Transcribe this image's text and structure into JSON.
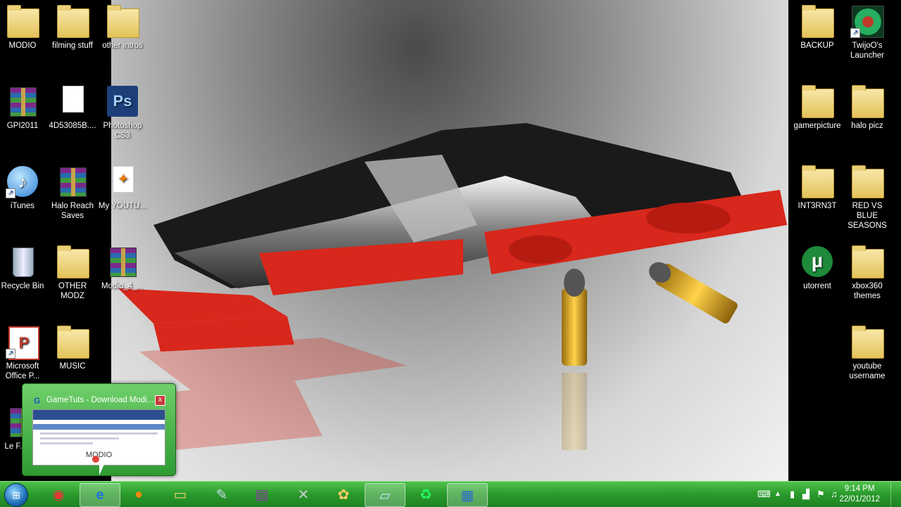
{
  "desktop_icons_left": [
    {
      "label": "MODIO",
      "kind": "folder"
    },
    {
      "label": "filming stuff",
      "kind": "folder"
    },
    {
      "label": "other intros",
      "kind": "folder"
    },
    {
      "label": "GPI2011",
      "kind": "rar"
    },
    {
      "label": "4D53085B....",
      "kind": "file"
    },
    {
      "label": "Photoshop CS3",
      "kind": "photoshop"
    },
    {
      "label": "iTunes",
      "kind": "itunes"
    },
    {
      "label": "Halo Reach Saves",
      "kind": "rar"
    },
    {
      "label": "My YOUTU...",
      "kind": "document"
    },
    {
      "label": "Recycle Bin",
      "kind": "recycle-bin"
    },
    {
      "label": "OTHER MODZ",
      "kind": "folder"
    },
    {
      "label": "Modio_4_...",
      "kind": "rar"
    },
    {
      "label": "Microsoft Office P...",
      "kind": "office"
    },
    {
      "label": "MUSIC",
      "kind": "folder"
    },
    {
      "label": "Le F... A...",
      "kind": "rar"
    }
  ],
  "desktop_icons_right": [
    {
      "label": "BACKUP",
      "kind": "folder"
    },
    {
      "label": "TwijoO's Launcher",
      "kind": "avatar"
    },
    {
      "label": "gamerpicture",
      "kind": "folder"
    },
    {
      "label": "halo picz",
      "kind": "folder"
    },
    {
      "label": "INT3RN3T",
      "kind": "folder"
    },
    {
      "label": "RED VS BLUE SEASONS",
      "kind": "folder"
    },
    {
      "label": "utorrent",
      "kind": "utorrent"
    },
    {
      "label": "xbox360 themes",
      "kind": "folder"
    },
    {
      "label": "youtube username",
      "kind": "folder"
    }
  ],
  "thumbnail_preview": {
    "title": "GameTuts - Download Modi...",
    "icon_letter": "G",
    "close_glyph": "x",
    "hover_label": "MODIO"
  },
  "taskbar": {
    "start_glyph": "⊞",
    "buttons": [
      {
        "name": "chrome",
        "glyph": "◉",
        "active": false
      },
      {
        "name": "internet-explorer",
        "glyph": "e",
        "active": true
      },
      {
        "name": "firefox",
        "glyph": "●",
        "active": false
      },
      {
        "name": "explorer",
        "glyph": "▭",
        "active": false
      },
      {
        "name": "app-paint",
        "glyph": "✎",
        "active": false
      },
      {
        "name": "winrar",
        "glyph": "▤",
        "active": false
      },
      {
        "name": "xbox",
        "glyph": "✕",
        "active": false
      },
      {
        "name": "paint-palette",
        "glyph": "✿",
        "active": false
      },
      {
        "name": "notepad",
        "glyph": "▱",
        "active": true
      },
      {
        "name": "recycle",
        "glyph": "♻",
        "active": false
      },
      {
        "name": "movie-maker",
        "glyph": "▦",
        "active": true
      }
    ],
    "tray": {
      "time": "9:14 PM",
      "date": "22/01/2012"
    }
  },
  "colors": {
    "taskbar_green": "#2a9a2c",
    "preview_green": "#4fb84a"
  }
}
